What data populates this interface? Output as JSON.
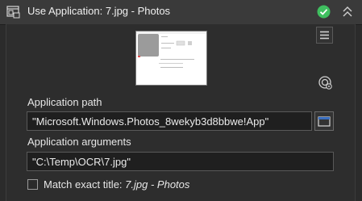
{
  "header": {
    "title": "Use Application: 7.jpg - Photos",
    "status_icon": "check-circle-icon",
    "status_color": "#3fbf5f",
    "collapse_icon": "double-chevron-up-icon"
  },
  "toolbar": {
    "menu_icon": "hamburger-menu-icon",
    "target_icon": "target-settings-icon"
  },
  "application_path": {
    "label": "Application path",
    "value": "\"Microsoft.Windows.Photos_8wekyb3d8bbwe!App\"",
    "browse_icon": "browse-window-icon"
  },
  "application_arguments": {
    "label": "Application arguments",
    "value": "\"C:\\Temp\\OCR\\7.jpg\""
  },
  "match_exact_title": {
    "label": "Match exact title:",
    "title_value": "7.jpg - Photos",
    "checked": false
  }
}
